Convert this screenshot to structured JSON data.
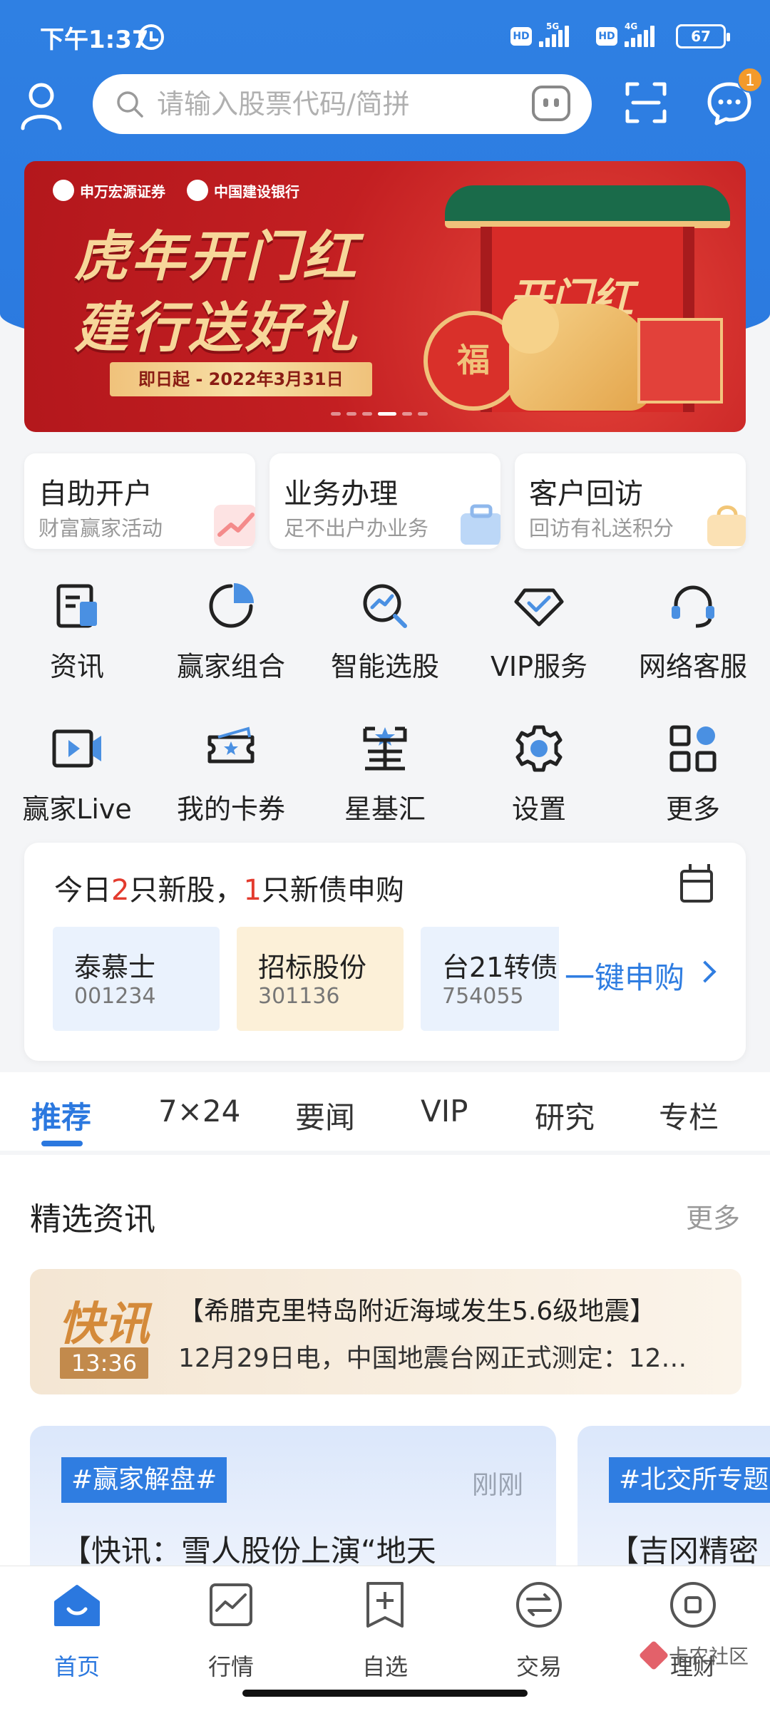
{
  "status_bar": {
    "time": "下午1:37",
    "hd1": "HD",
    "net1": "5G",
    "hd2": "HD",
    "net2": "4G",
    "battery": "67"
  },
  "header": {
    "search_placeholder": "请输入股票代码/简拼",
    "message_badge": "1"
  },
  "banner": {
    "logo1": "申万宏源证券",
    "logo2": "中国建设银行",
    "title_line1": "虎年开门红",
    "title_line2": "建行送好礼",
    "date_text": "即日起 - 2022年3月31日",
    "gate_text": "开门红",
    "drum_text": "福",
    "slide_count": 6,
    "active_slide": 3
  },
  "service_cards": [
    {
      "title": "自助开户",
      "subtitle": "财富赢家活动",
      "accent": "#f5a3a3"
    },
    {
      "title": "业务办理",
      "subtitle": "足不出户办业务",
      "accent": "#a9c9f3"
    },
    {
      "title": "客户回访",
      "subtitle": "回访有礼送积分",
      "accent": "#f6d7a1"
    }
  ],
  "grid": [
    {
      "label": "资讯",
      "icon": "news-icon"
    },
    {
      "label": "赢家组合",
      "icon": "pie-chart-icon"
    },
    {
      "label": "智能选股",
      "icon": "magnifier-chart-icon"
    },
    {
      "label": "VIP服务",
      "icon": "diamond-icon"
    },
    {
      "label": "网络客服",
      "icon": "headset-icon"
    },
    {
      "label": "赢家Live",
      "icon": "video-play-icon"
    },
    {
      "label": "我的卡券",
      "icon": "ticket-star-icon"
    },
    {
      "label": "星基汇",
      "icon": "star-fund-icon"
    },
    {
      "label": "设置",
      "icon": "gear-icon"
    },
    {
      "label": "更多",
      "icon": "apps-grid-icon"
    }
  ],
  "ipo": {
    "title_prefix": "今日",
    "new_stock_count": "2",
    "title_mid": "只新股，",
    "new_bond_count": "1",
    "title_suffix": "只新债申购",
    "items": [
      {
        "name": "泰慕士",
        "code": "001234",
        "bg": "#eaf2fd"
      },
      {
        "name": "招标股份",
        "code": "301136",
        "bg": "#fcf0d8"
      },
      {
        "name": "台21转债",
        "code": "754055",
        "bg": "#eaf2fd"
      }
    ],
    "action_label": "一键申购"
  },
  "news_tabs": [
    "推荐",
    "7×24",
    "要闻",
    "VIP",
    "研究",
    "专栏"
  ],
  "active_tab": 0,
  "featured": {
    "title": "精选资讯",
    "more": "更多",
    "flash": {
      "logo": "快讯",
      "time": "13:36",
      "headline": "【希腊克里特岛附近海域发生5.6级地震】",
      "body": "12月29日电，中国地震台网正式测定：12…"
    },
    "cards": [
      {
        "tag": "#赢家解盘#",
        "time": "刚刚",
        "title": "【快讯：雪人股份上演“地天"
      },
      {
        "tag": "#北交所专题",
        "time": "",
        "title": "【吉冈精密"
      }
    ]
  },
  "bottom_nav": [
    {
      "label": "首页",
      "icon": "home-icon"
    },
    {
      "label": "行情",
      "icon": "market-chart-icon"
    },
    {
      "label": "自选",
      "icon": "bookmark-plus-icon"
    },
    {
      "label": "交易",
      "icon": "exchange-icon"
    },
    {
      "label": "理财",
      "icon": "wealth-icon"
    }
  ],
  "active_nav": 0,
  "watermark": "卡农社区",
  "colors": {
    "brand_blue": "#2f80e3",
    "accent_red": "#e33b2e",
    "tab_active": "#2b78df"
  }
}
